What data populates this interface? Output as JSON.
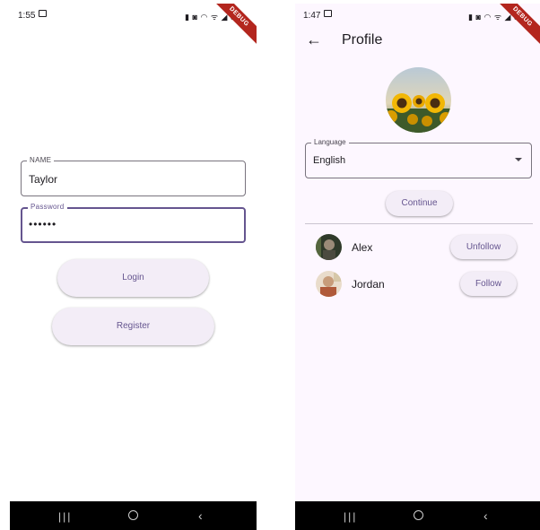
{
  "left_screen": {
    "status_time": "1:55",
    "status_icons": "▮ ◙ ◠ ᯤ ◢ 57",
    "ribbon": "DEBUG",
    "form": {
      "name_label": "NAME",
      "name_value": "Taylor",
      "password_label": "Password",
      "password_value": "••••••",
      "login_label": "Login",
      "register_label": "Register"
    }
  },
  "right_screen": {
    "status_time": "1:47",
    "status_icons": "▮ ◙ ◠ ᯤ ◢ 55",
    "ribbon": "DEBUG",
    "appbar": {
      "title": "Profile"
    },
    "language": {
      "label": "Language",
      "value": "English"
    },
    "continue_label": "Continue",
    "users": [
      {
        "name": "Alex",
        "action": "Unfollow"
      },
      {
        "name": "Jordan",
        "action": "Follow"
      }
    ]
  },
  "navbar": {
    "recent": "|||",
    "back": "‹"
  },
  "colors": {
    "accent": "#65558f",
    "button_bg": "#f3edf7",
    "surface_right": "#fdf7ff",
    "outline": "#79747e"
  },
  "icons": [
    "image-notification-icon",
    "back-arrow-icon",
    "dropdown-caret-icon",
    "recent-apps-icon",
    "home-icon",
    "system-back-icon"
  ]
}
